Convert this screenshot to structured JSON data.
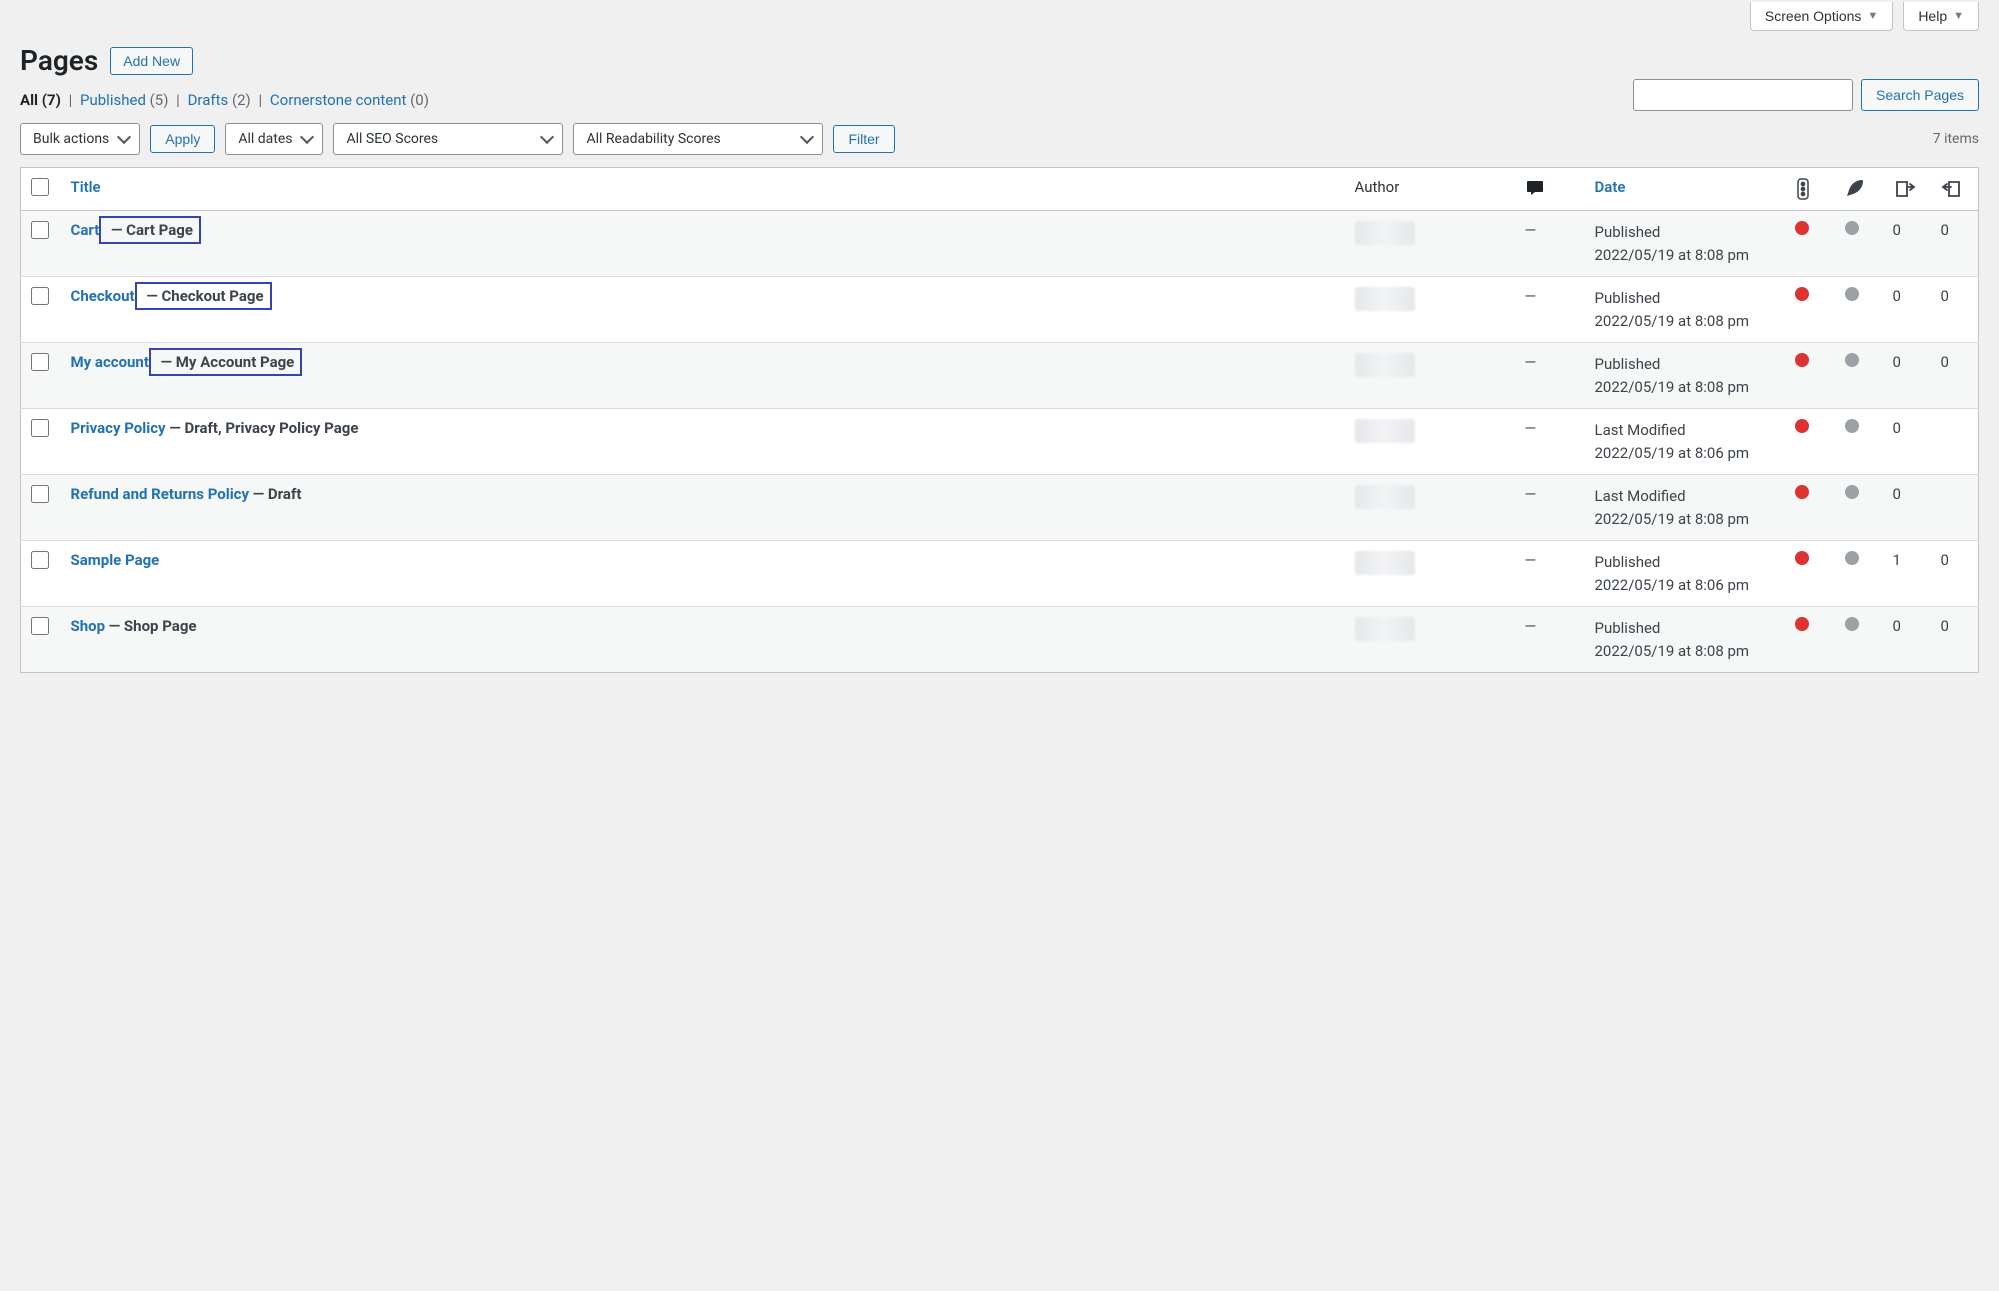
{
  "screenOptions": {
    "screenOptions_label": "Screen Options",
    "help_label": "Help"
  },
  "header": {
    "title": "Pages",
    "addNew": "Add New"
  },
  "filters": {
    "all": "All",
    "allCount": "(7)",
    "published": "Published",
    "publishedCount": "(5)",
    "drafts": "Drafts",
    "draftsCount": "(2)",
    "cornerstone": "Cornerstone content",
    "cornerstoneCount": "(0)"
  },
  "search": {
    "button": "Search Pages"
  },
  "tablenav": {
    "bulk": "Bulk actions",
    "apply": "Apply",
    "allDates": "All dates",
    "allSeo": "All SEO Scores",
    "allRead": "All Readability Scores",
    "filter": "Filter",
    "countText": "7 items"
  },
  "columns": {
    "title": "Title",
    "author": "Author",
    "date": "Date"
  },
  "rows": [
    {
      "title": "Cart",
      "state": " — Cart Page",
      "boxed": true,
      "author_blur": true,
      "comments": "—",
      "date_status": "Published",
      "date_line": "2022/05/19 at 8:08 pm",
      "seo1": "red",
      "seo2": "grey",
      "links1": "0",
      "links2": "0"
    },
    {
      "title": "Checkout",
      "state": " — Checkout Page",
      "boxed": true,
      "author_blur": true,
      "comments": "—",
      "date_status": "Published",
      "date_line": "2022/05/19 at 8:08 pm",
      "seo1": "red",
      "seo2": "grey",
      "links1": "0",
      "links2": "0"
    },
    {
      "title": "My account",
      "state": " — My Account Page",
      "boxed": true,
      "author_blur": true,
      "comments": "—",
      "date_status": "Published",
      "date_line": "2022/05/19 at 8:08 pm",
      "seo1": "red",
      "seo2": "grey",
      "links1": "0",
      "links2": "0"
    },
    {
      "title": "Privacy Policy",
      "state": " — Draft, Privacy Policy Page",
      "boxed": false,
      "author_blur": true,
      "comments": "—",
      "date_status": "Last Modified",
      "date_line": "2022/05/19 at 8:06 pm",
      "seo1": "red",
      "seo2": "grey",
      "links1": "0",
      "links2": ""
    },
    {
      "title": "Refund and Returns Policy",
      "state": " — Draft",
      "boxed": false,
      "author_blur": true,
      "comments": "—",
      "date_status": "Last Modified",
      "date_line": "2022/05/19 at 8:08 pm",
      "seo1": "red",
      "seo2": "grey",
      "links1": "0",
      "links2": ""
    },
    {
      "title": "Sample Page",
      "state": "",
      "boxed": false,
      "author_blur": true,
      "comments": "—",
      "date_status": "Published",
      "date_line": "2022/05/19 at 8:06 pm",
      "seo1": "red",
      "seo2": "grey",
      "links1": "1",
      "links2": "0"
    },
    {
      "title": "Shop",
      "state": " — Shop Page",
      "boxed": false,
      "author_blur": true,
      "comments": "—",
      "date_status": "Published",
      "date_line": "2022/05/19 at 8:08 pm",
      "seo1": "red",
      "seo2": "grey",
      "links1": "0",
      "links2": "0"
    }
  ]
}
